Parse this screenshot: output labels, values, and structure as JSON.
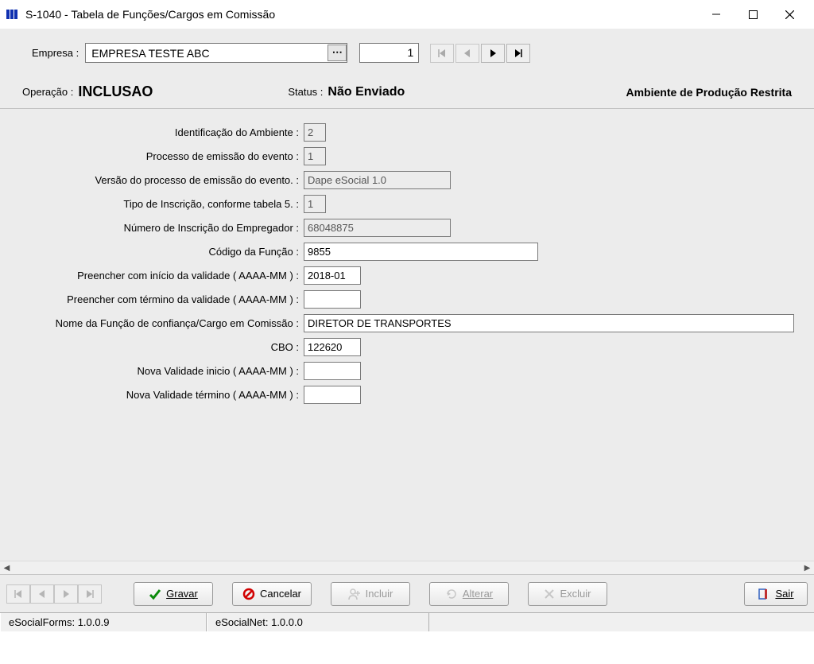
{
  "window": {
    "title": "S-1040 - Tabela de Funções/Cargos em Comissão"
  },
  "empresa": {
    "label": "Empresa :",
    "value": "EMPRESA TESTE ABC",
    "recno": "1"
  },
  "opline": {
    "op_label": "Operação :",
    "op_value": "INCLUSAO",
    "status_label": "Status :",
    "status_value": "Não Enviado",
    "env": "Ambiente de Produção Restrita"
  },
  "fields": {
    "ident_amb": {
      "label": "Identificação do Ambiente :",
      "value": "2"
    },
    "proc_emissao": {
      "label": "Processo de emissão do evento :",
      "value": "1"
    },
    "ver_proc": {
      "label": "Versão do processo de emissão do evento. :",
      "value": "Dape eSocial 1.0"
    },
    "tipo_inscr": {
      "label": "Tipo de Inscrição, conforme tabela 5. :",
      "value": "1"
    },
    "num_inscr": {
      "label": "Número de Inscrição do Empregador :",
      "value": "68048875"
    },
    "cod_funcao": {
      "label": "Código da Função :",
      "value": "9855"
    },
    "ini_validade": {
      "label": "Preencher com início da validade ( AAAA-MM ) :",
      "value": "2018-01"
    },
    "fim_validade": {
      "label": "Preencher com término da validade ( AAAA-MM ) :",
      "value": ""
    },
    "nome_funcao": {
      "label": "Nome da Função de confiança/Cargo em Comissão :",
      "value": "DIRETOR DE TRANSPORTES"
    },
    "cbo": {
      "label": "CBO :",
      "value": "122620"
    },
    "nova_ini": {
      "label": "Nova Validade inicio ( AAAA-MM ) :",
      "value": ""
    },
    "nova_fim": {
      "label": "Nova Validade término ( AAAA-MM ) :",
      "value": ""
    }
  },
  "buttons": {
    "gravar": "Gravar",
    "cancelar": "Cancelar",
    "incluir": "Incluir",
    "alterar": "Alterar",
    "excluir": "Excluir",
    "sair": "Sair"
  },
  "statusbar": {
    "forms": "eSocialForms: 1.0.0.9",
    "net": "eSocialNet: 1.0.0.0"
  }
}
